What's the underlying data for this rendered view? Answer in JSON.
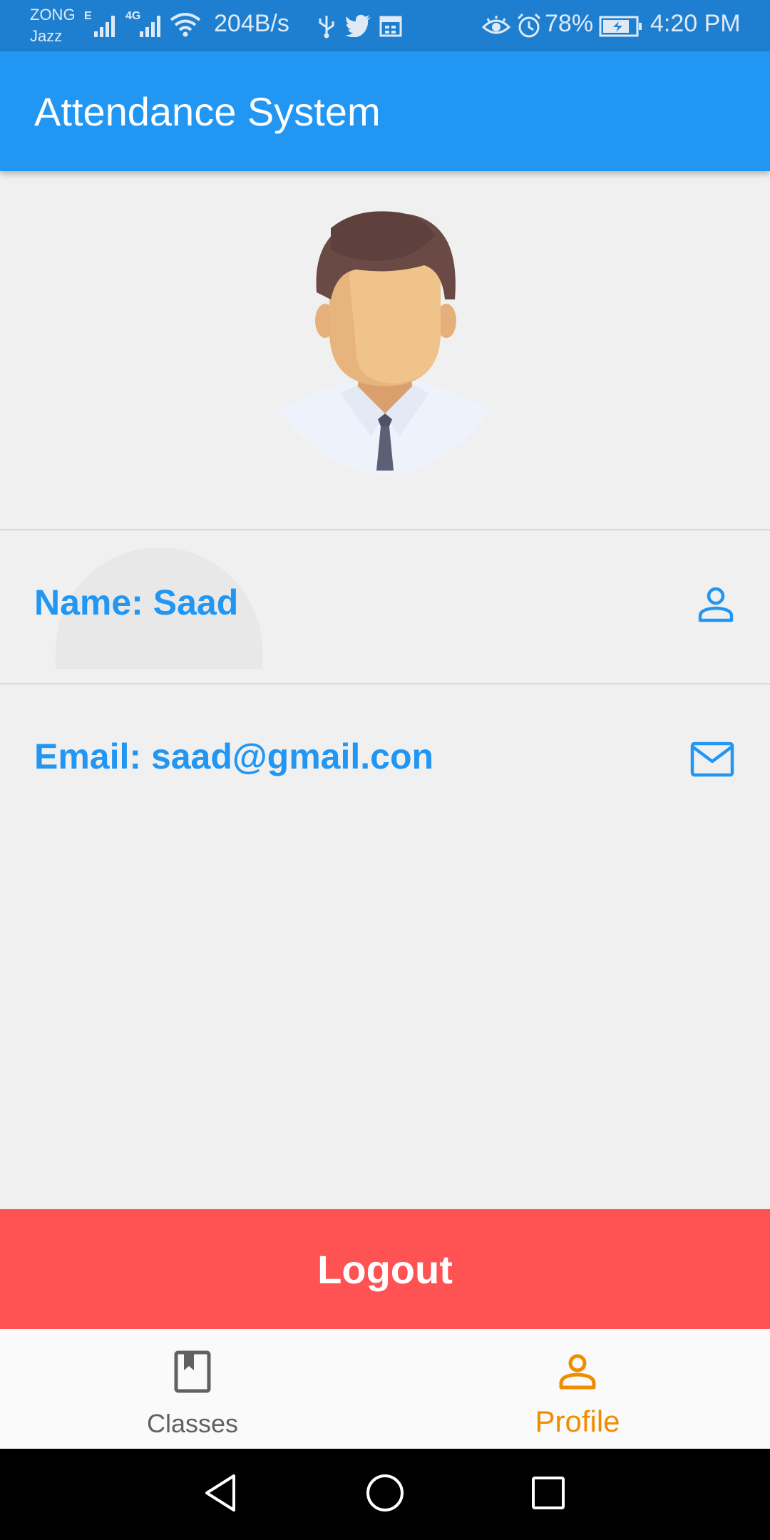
{
  "status_bar": {
    "carrier_1": "ZONG",
    "carrier_2": "Jazz",
    "net_1": "E",
    "net_2": "4G",
    "speed": "204B/s",
    "battery": "78%",
    "time": "4:20 PM",
    "icons": [
      "signal-icon",
      "wifi-icon",
      "usb-icon",
      "twitter-icon",
      "calendar-icon",
      "eye-icon",
      "alarm-icon",
      "battery-icon"
    ]
  },
  "app_bar": {
    "title": "Attendance System"
  },
  "profile": {
    "name_label": "Name: Saad",
    "email_label": "Email: saad@gmail.con",
    "name_icon": "person-icon",
    "email_icon": "mail-icon"
  },
  "logout": {
    "label": "Logout"
  },
  "bottom_nav": {
    "items": [
      {
        "label": "Classes",
        "icon": "book-icon",
        "active": false
      },
      {
        "label": "Profile",
        "icon": "person-icon",
        "active": true
      }
    ]
  },
  "colors": {
    "primary": "#2196f3",
    "status_bar": "#1e7fd1",
    "logout": "#ff5252",
    "active_nav": "#f08c00",
    "inactive_nav": "#616161"
  }
}
